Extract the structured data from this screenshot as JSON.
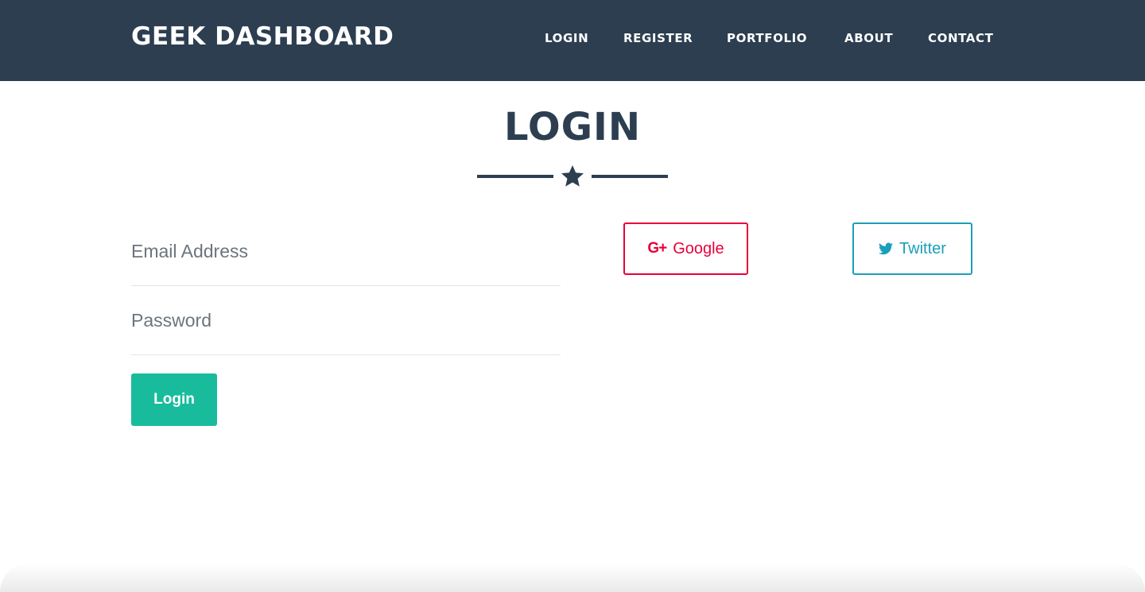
{
  "header": {
    "brand": "GEEK DASHBOARD",
    "nav": [
      {
        "label": "LOGIN"
      },
      {
        "label": "REGISTER"
      },
      {
        "label": "PORTFOLIO"
      },
      {
        "label": "ABOUT"
      },
      {
        "label": "CONTACT"
      }
    ]
  },
  "main": {
    "title": "LOGIN",
    "divider_icon": "star-icon",
    "form": {
      "email": {
        "placeholder": "Email Address",
        "value": ""
      },
      "password": {
        "placeholder": "Password",
        "value": ""
      },
      "submit_label": "Login"
    },
    "social": {
      "google": {
        "icon": "google-plus-icon",
        "icon_text": "G+",
        "label": "Google"
      },
      "twitter": {
        "icon": "twitter-bird-icon",
        "label": "Twitter"
      }
    }
  },
  "colors": {
    "navbar": "#2c3e50",
    "primary": "#2c3e50",
    "success": "#18bc9c",
    "google": "#e8003a",
    "twitter": "#1a9fba"
  }
}
